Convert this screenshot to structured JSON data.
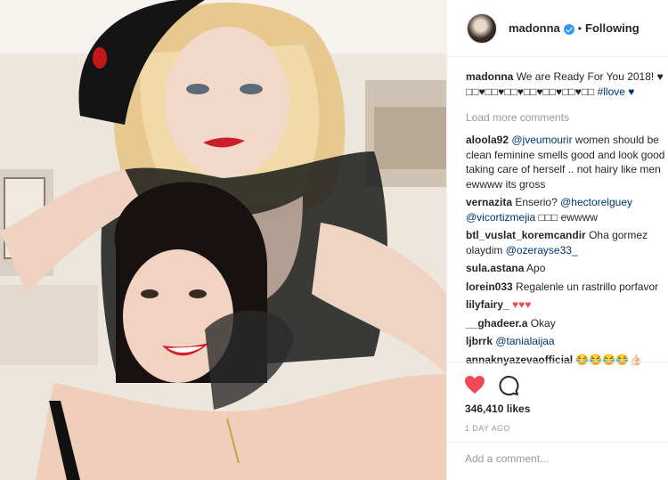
{
  "post": {
    "username": "madonna",
    "follow_status": "Following",
    "dot": "•",
    "caption": {
      "user": "madonna",
      "text": "We are Ready For You 2018! ♥",
      "line2": "□□♥□□♥□□♥□□♥□□♥□□♥□□",
      "hashtag": "#llove ♥"
    },
    "load_more": "Load more comments",
    "comments": [
      {
        "user": "aloola92",
        "mention": "@jveumourir",
        "text": "women should be clean feminine smells good and look good by taking care of herself .. not hairy like men ewwww its gross"
      },
      {
        "user": "vernazita",
        "text_pre": "Enserio?",
        "mention": "@hectorelguey",
        "mention2": "@vicortizmejia",
        "text": "□□□ ewwww"
      },
      {
        "user": "btl_vuslat_koremcandir",
        "text": "Oha gormez olaydim",
        "mention": "@ozerayse33_"
      },
      {
        "user": "sula.astana",
        "text": "Apo"
      },
      {
        "user": "lorein033",
        "text": "Regalenle un rastrillo porfavor"
      },
      {
        "user": "lilyfairy_",
        "text": "♥♥♥"
      },
      {
        "user": "__ghadeer.a",
        "text": "Okay"
      },
      {
        "user": "ljbrrk",
        "mention": "@tanialaijaa"
      },
      {
        "user": "annaknyazevaofficial",
        "text": "😂😂😂😂👍🏻"
      }
    ],
    "likes": "346,410 likes",
    "timestamp": "1 DAY AGO",
    "add_comment_placeholder": "Add a comment..."
  },
  "icons": {
    "like": "heart-icon",
    "comment": "comment-icon",
    "verified": "verified-badge-icon"
  },
  "colors": {
    "liked": "#ed4956",
    "link": "#003569",
    "verified": "#3897f0",
    "muted": "#999999"
  }
}
